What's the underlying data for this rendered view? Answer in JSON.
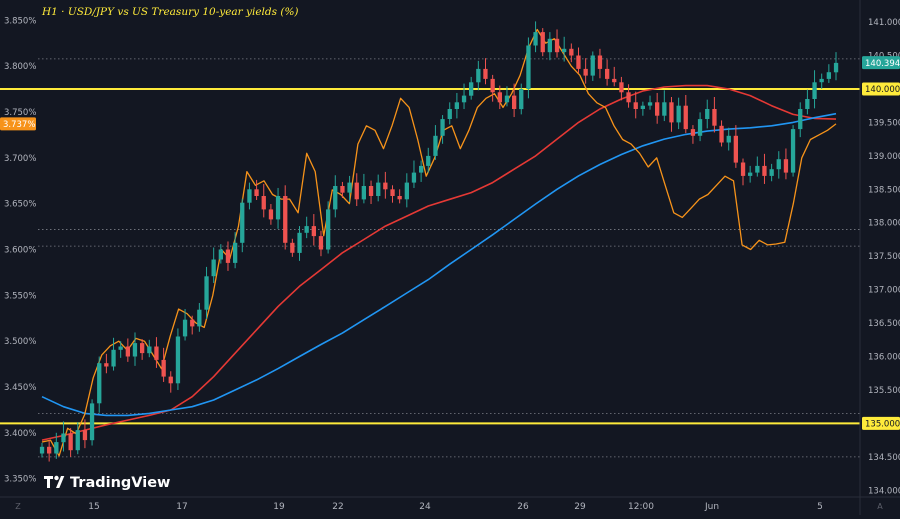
{
  "title": "H1 · USD/JPY vs US Treasury 10-year yields (%)",
  "brand": "TradingView",
  "colors": {
    "background": "#131722",
    "grid": "#2a2e39",
    "axis_text": "#b2b5be",
    "candle_up": "#26a69a",
    "candle_down": "#ef5350",
    "yield_line": "#f7931a",
    "ma_red": "#e53935",
    "ma_blue": "#2196f3",
    "level_line": "#ffeb3b",
    "price_badge": "#26a69a"
  },
  "left_axis": {
    "ticks": [
      "3.850%",
      "3.800%",
      "3.750%",
      "3.700%",
      "3.650%",
      "3.600%",
      "3.550%",
      "3.500%",
      "3.450%",
      "3.400%",
      "3.350%"
    ]
  },
  "right_axis": {
    "ticks": [
      "141.000",
      "140.500",
      "140.000",
      "139.500",
      "139.000",
      "138.500",
      "138.000",
      "137.500",
      "137.000",
      "136.500",
      "136.000",
      "135.500",
      "135.000",
      "134.500",
      "134.000"
    ]
  },
  "x_axis": {
    "ticks": [
      "15",
      "17",
      "19",
      "22",
      "24",
      "26",
      "29",
      "12:00",
      "Jun",
      "5"
    ]
  },
  "corner_labels": {
    "left": "Z",
    "right": "A"
  },
  "badges": {
    "yield_current": "3.737%",
    "price_current": "140.394",
    "level_high": "140.000",
    "level_low": "135.000"
  },
  "chart_data": {
    "type": "line",
    "title": "H1 · USD/JPY vs US Treasury 10-year yields (%)",
    "x_labels": [
      "15",
      "17",
      "19",
      "22",
      "24",
      "26",
      "29",
      "12:00",
      "Jun",
      "5"
    ],
    "y_left_range": [
      3.33,
      3.87
    ],
    "y_right_range": [
      133.9,
      141.3
    ],
    "grid": false,
    "horizontal_levels": [
      140.0,
      135.0
    ],
    "dotted_levels": [
      140.45,
      137.9,
      137.65,
      135.15,
      134.5
    ],
    "series": [
      {
        "name": "USD/JPY",
        "kind": "candlestick",
        "axis": "right",
        "values": [
          134.65,
          134.55,
          134.72,
          134.85,
          134.6,
          134.9,
          134.75,
          135.3,
          135.9,
          135.85,
          136.1,
          136.15,
          136.0,
          136.2,
          136.05,
          136.15,
          135.95,
          135.7,
          135.6,
          136.3,
          136.55,
          136.45,
          136.7,
          137.2,
          137.45,
          137.6,
          137.4,
          137.7,
          138.3,
          138.5,
          138.4,
          138.2,
          138.05,
          138.4,
          137.7,
          137.55,
          137.85,
          137.95,
          137.8,
          137.6,
          138.2,
          138.55,
          138.45,
          138.6,
          138.35,
          138.55,
          138.4,
          138.6,
          138.5,
          138.4,
          138.35,
          138.6,
          138.75,
          138.85,
          139.0,
          139.3,
          139.55,
          139.7,
          139.8,
          139.9,
          140.1,
          140.3,
          140.15,
          139.95,
          139.8,
          139.9,
          139.7,
          140.0,
          140.65,
          140.85,
          140.55,
          140.75,
          140.55,
          140.6,
          140.5,
          140.3,
          140.2,
          140.5,
          140.3,
          140.15,
          140.1,
          139.95,
          139.8,
          139.7,
          139.75,
          139.8,
          139.6,
          139.8,
          139.5,
          139.75,
          139.4,
          139.3,
          139.55,
          139.7,
          139.45,
          139.2,
          139.3,
          138.9,
          138.7,
          138.75,
          138.85,
          138.7,
          138.8,
          138.95,
          138.75,
          139.4,
          139.7,
          139.85,
          140.1,
          140.15,
          140.25,
          140.39
        ]
      },
      {
        "name": "US Treasury 10-year yields (%)",
        "kind": "line",
        "axis": "left",
        "values": [
          3.39,
          3.392,
          3.375,
          3.405,
          3.399,
          3.42,
          3.46,
          3.485,
          3.495,
          3.5,
          3.49,
          3.503,
          3.5,
          3.485,
          3.47,
          3.505,
          3.535,
          3.53,
          3.52,
          3.515,
          3.55,
          3.6,
          3.59,
          3.625,
          3.685,
          3.67,
          3.675,
          3.66,
          3.655,
          3.655,
          3.64,
          3.705,
          3.685,
          3.615,
          3.665,
          3.66,
          3.65,
          3.715,
          3.735,
          3.73,
          3.71,
          3.735,
          3.765,
          3.755,
          3.72,
          3.68,
          3.7,
          3.73,
          3.735,
          3.71,
          3.73,
          3.755,
          3.765,
          3.77,
          3.755,
          3.77,
          3.79,
          3.82,
          3.84,
          3.825,
          3.83,
          3.815,
          3.8,
          3.79,
          3.77,
          3.76,
          3.755,
          3.735,
          3.72,
          3.715,
          3.705,
          3.69,
          3.7,
          3.67,
          3.64,
          3.635,
          3.645,
          3.655,
          3.66,
          3.67,
          3.68,
          3.675,
          3.605,
          3.6,
          3.61,
          3.605,
          3.606,
          3.608,
          3.65,
          3.7,
          3.72,
          3.725,
          3.73,
          3.737
        ]
      },
      {
        "name": "Moving average (red)",
        "kind": "line",
        "axis": "right",
        "values": [
          134.75,
          134.82,
          134.9,
          134.98,
          135.05,
          135.12,
          135.2,
          135.4,
          135.7,
          136.05,
          136.4,
          136.75,
          137.05,
          137.3,
          137.55,
          137.75,
          137.95,
          138.1,
          138.25,
          138.35,
          138.45,
          138.6,
          138.8,
          139.0,
          139.25,
          139.5,
          139.7,
          139.85,
          139.97,
          140.03,
          140.05,
          140.05,
          140.0,
          139.9,
          139.75,
          139.62,
          139.56,
          139.55
        ]
      },
      {
        "name": "Moving average (blue)",
        "kind": "line",
        "axis": "right",
        "values": [
          135.4,
          135.25,
          135.15,
          135.12,
          135.12,
          135.15,
          135.2,
          135.25,
          135.35,
          135.5,
          135.65,
          135.82,
          136.0,
          136.18,
          136.35,
          136.55,
          136.75,
          136.95,
          137.15,
          137.38,
          137.6,
          137.82,
          138.05,
          138.28,
          138.5,
          138.7,
          138.87,
          139.02,
          139.15,
          139.25,
          139.32,
          139.37,
          139.4,
          139.42,
          139.45,
          139.5,
          139.57,
          139.63
        ]
      }
    ]
  }
}
